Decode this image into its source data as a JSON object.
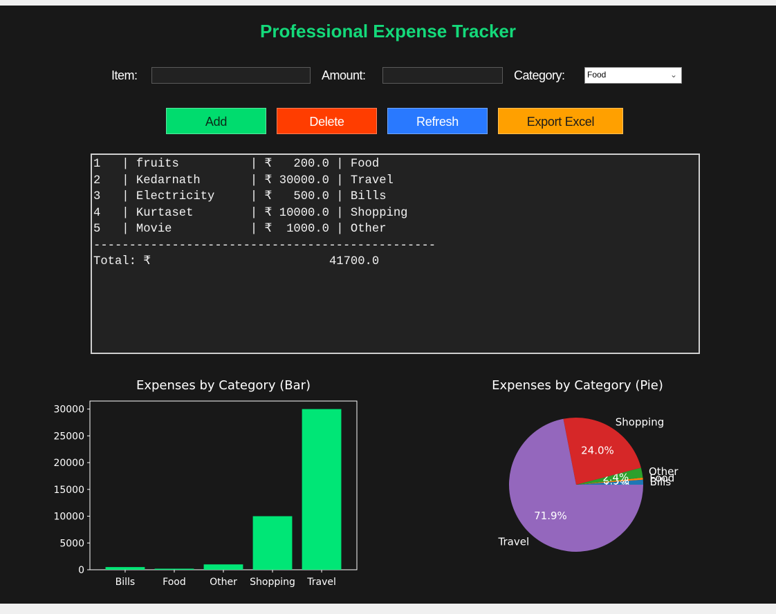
{
  "window": {
    "title": "Professional Expense Tracker",
    "background": "#181818",
    "accent": "#14d97a"
  },
  "form": {
    "item_label": "Item:",
    "item_value": "",
    "amount_label": "Amount:",
    "amount_value": "",
    "category_label": "Category:",
    "category_selected": "Food"
  },
  "buttons": {
    "add": {
      "label": "Add",
      "color": "#00dc6e"
    },
    "delete": {
      "label": "Delete",
      "color": "#ff3d00"
    },
    "refresh": {
      "label": "Refresh",
      "color": "#2979ff"
    },
    "export": {
      "label": "Export Excel",
      "color": "#ffa000"
    }
  },
  "expenses": {
    "rows": [
      {
        "id": "1",
        "item": "fruits",
        "amount": "200.0",
        "category": "Food"
      },
      {
        "id": "2",
        "item": "Kedarnath",
        "amount": "30000.0",
        "category": "Travel"
      },
      {
        "id": "3",
        "item": "Electricity",
        "amount": "500.0",
        "category": "Bills"
      },
      {
        "id": "4",
        "item": "Kurtaset",
        "amount": "10000.0",
        "category": "Shopping"
      },
      {
        "id": "5",
        "item": "Movie",
        "amount": "1000.0",
        "category": "Other"
      }
    ],
    "currency": "₹",
    "separator": "------------------------------------------------",
    "total_label": "Total: ₹",
    "total_value": "41700.0"
  },
  "chart_data": [
    {
      "type": "bar",
      "title": "Expenses by Category (Bar)",
      "categories": [
        "Bills",
        "Food",
        "Other",
        "Shopping",
        "Travel"
      ],
      "values": [
        500,
        200,
        1000,
        10000,
        30000
      ],
      "ylim": [
        0,
        31500
      ],
      "yticks": [
        0,
        5000,
        10000,
        15000,
        20000,
        25000,
        30000
      ],
      "color": "#00e676",
      "grid": false
    },
    {
      "type": "pie",
      "title": "Expenses by Category (Pie)",
      "labels": [
        "Bills",
        "Food",
        "Other",
        "Shopping",
        "Travel"
      ],
      "values": [
        500,
        200,
        1000,
        10000,
        30000
      ],
      "percent_labels": [
        "1.2%",
        "0.5%",
        "2.4%",
        "24.0%",
        "71.9%"
      ],
      "colors": [
        "#1f77b4",
        "#ff7f0e",
        "#2ca02c",
        "#d62728",
        "#9467bd"
      ]
    }
  ]
}
